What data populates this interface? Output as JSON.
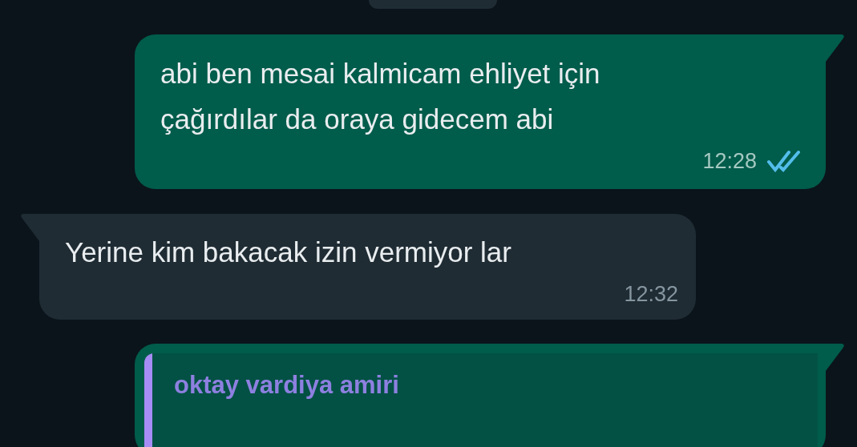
{
  "messages": [
    {
      "kind": "outgoing",
      "text": "abi ben mesai kalmicam ehliyet için\nçağırdılar da oraya gidecem abi",
      "time": "12:28",
      "read": true
    },
    {
      "kind": "incoming",
      "text": "Yerine kim bakacak izin vermiyor lar",
      "time": "12:32"
    },
    {
      "kind": "outgoing_reply",
      "quoted_author": "oktay vardiya amiri"
    }
  ]
}
